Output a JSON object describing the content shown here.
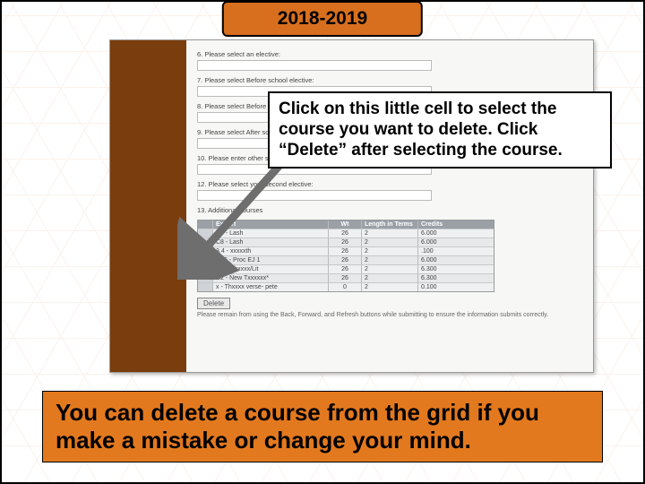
{
  "header": {
    "year": "2018-2019"
  },
  "callout": {
    "text": "Click on this little cell to select the course you want to delete. Click “Delete” after selecting the course."
  },
  "banner": {
    "text": "You can delete a course from the grid if you make a mistake or change your mind."
  },
  "form": {
    "q6": "6. Please select an elective:",
    "q7": "7. Please select Before school elective:",
    "q8": "8. Please select Before school elective:",
    "q9": "9. Please select After school elective:",
    "q10": "10. Please enter other school elective:",
    "q12": "12. Please select your second elective:",
    "q13": "13. Additional courses",
    "grid": {
      "headers": {
        "course": "Export",
        "wt": "Wt",
        "length": "Length in Terms",
        "credits": "Credits",
        "sem": "Semesters"
      },
      "rows": [
        {
          "course": "C7 - Lash",
          "wt": "26",
          "length": "2",
          "credits": "6.000",
          "sem": ""
        },
        {
          "course": "C8 - Lash",
          "wt": "26",
          "length": "2",
          "credits": "6.000",
          "sem": ""
        },
        {
          "course": "3.4 - xxxxxth",
          "wt": "26",
          "length": "2",
          "credits": ".100",
          "sem": ""
        },
        {
          "course": "C15 - Proc EJ 1",
          "wt": "26",
          "length": "2",
          "credits": "6.000",
          "sem": ""
        },
        {
          "course": "C1 - Chxxxx/Lit",
          "wt": "26",
          "length": "2",
          "credits": "6.300",
          "sem": ""
        },
        {
          "course": "C2 - New Txxxxxx*",
          "wt": "26",
          "length": "2",
          "credits": "6.300",
          "sem": ""
        },
        {
          "course": "x - Thxxxx verse- pete",
          "wt": "0",
          "length": "2",
          "credits": "0.100",
          "sem": ""
        }
      ]
    },
    "delete_label": "Delete",
    "hint": "Please remain from using the Back, Forward, and Refresh buttons while submitting to ensure the information submits correctly."
  }
}
